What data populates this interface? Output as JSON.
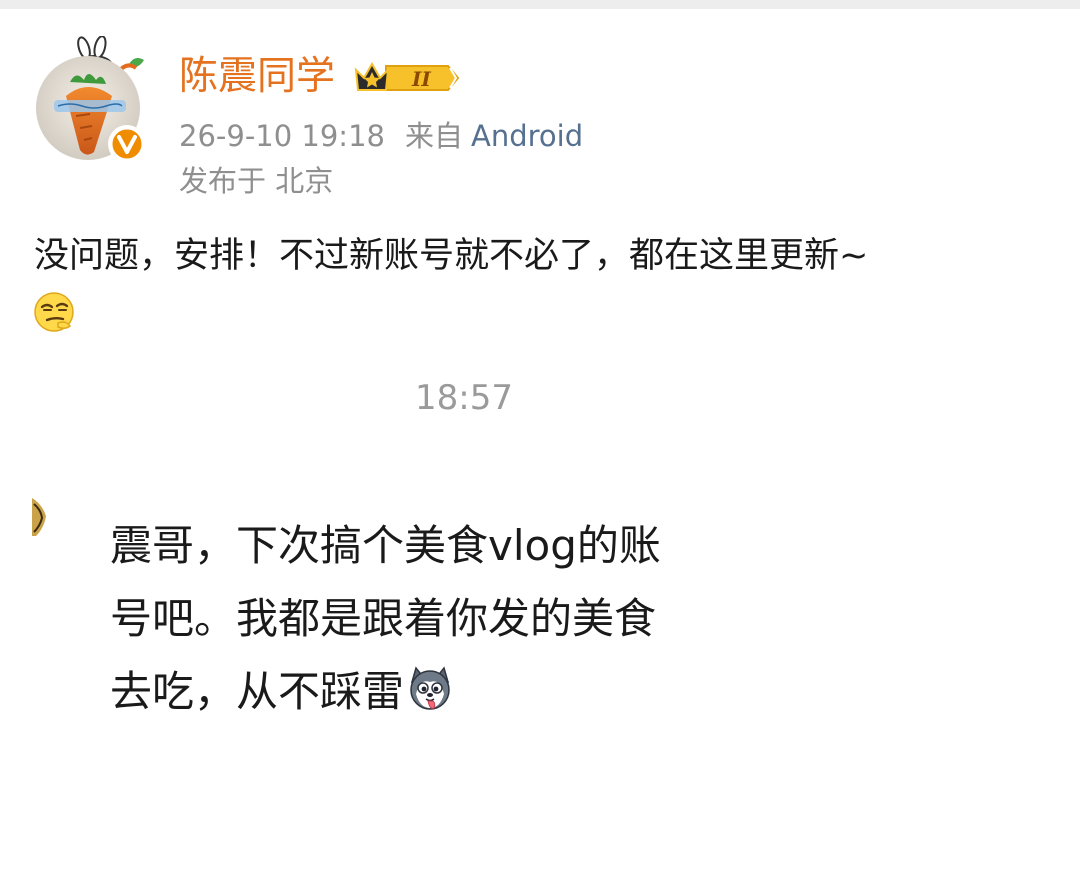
{
  "post": {
    "user_name": "陈震同学",
    "vip_level": "II",
    "timestamp": "26-9-10 19:18",
    "source_label": "来自",
    "source_app": "Android",
    "location": "发布于 北京",
    "text": "没问题，安排！不过新账号就不必了，都在这里更新~",
    "emoji": "smirk-emoji"
  },
  "chat": {
    "time": "18:57",
    "message_lines": [
      "震哥，下次搞个美食vlog的账",
      "号吧。我都是跟着你发的美食",
      "去吃，从不踩雷"
    ],
    "emoji": "husky-emoji"
  },
  "colors": {
    "username": "#e5721f",
    "source_link": "#56708f",
    "meta_gray": "#8f8f8f",
    "verified": "#f08c00",
    "vip_gold": "#f6c12a"
  }
}
